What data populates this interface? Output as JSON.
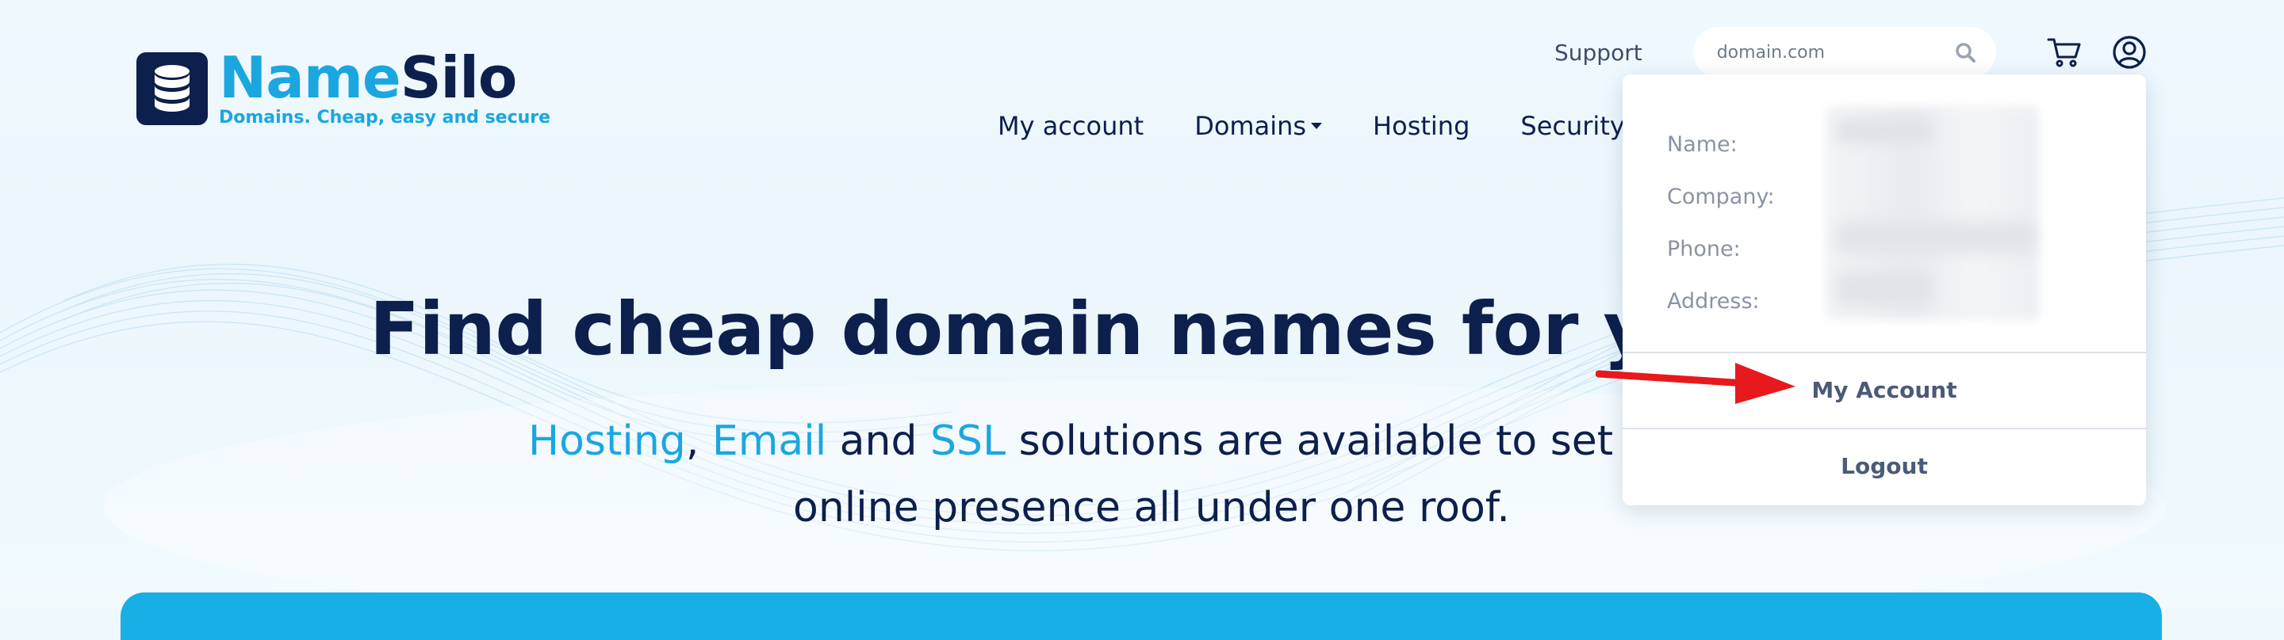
{
  "brand": {
    "name_part1": "Name",
    "name_part2": "Silo",
    "tagline": "Domains. Cheap, easy and secure"
  },
  "topbar": {
    "support_label": "Support",
    "search_placeholder": "domain.com",
    "icons": [
      "search-icon",
      "cart-icon",
      "user-icon"
    ]
  },
  "nav": {
    "items": [
      {
        "label": "My account",
        "has_caret": false
      },
      {
        "label": "Domains",
        "has_caret": true
      },
      {
        "label": "Hosting",
        "has_caret": false
      },
      {
        "label": "Security",
        "has_caret": true
      }
    ]
  },
  "hero": {
    "title": "Find cheap domain names for your",
    "sub_hosting": "Hosting",
    "sub_sep": ",",
    "sub_email": "Email",
    "sub_and": " and ",
    "sub_ssl": "SSL",
    "sub_rest": " solutions are available to set u",
    "sub_line2": "online presence all under one roof."
  },
  "account_dropdown": {
    "fields": [
      {
        "label": "Name:"
      },
      {
        "label": "Company:"
      },
      {
        "label": "Phone:"
      },
      {
        "label": "Address:"
      }
    ],
    "my_account_label": "My Account",
    "logout_label": "Logout"
  },
  "colors": {
    "brand_dark": "#0d1f4c",
    "brand_blue": "#1ba6e0",
    "annotation_arrow": "#e8191c"
  }
}
